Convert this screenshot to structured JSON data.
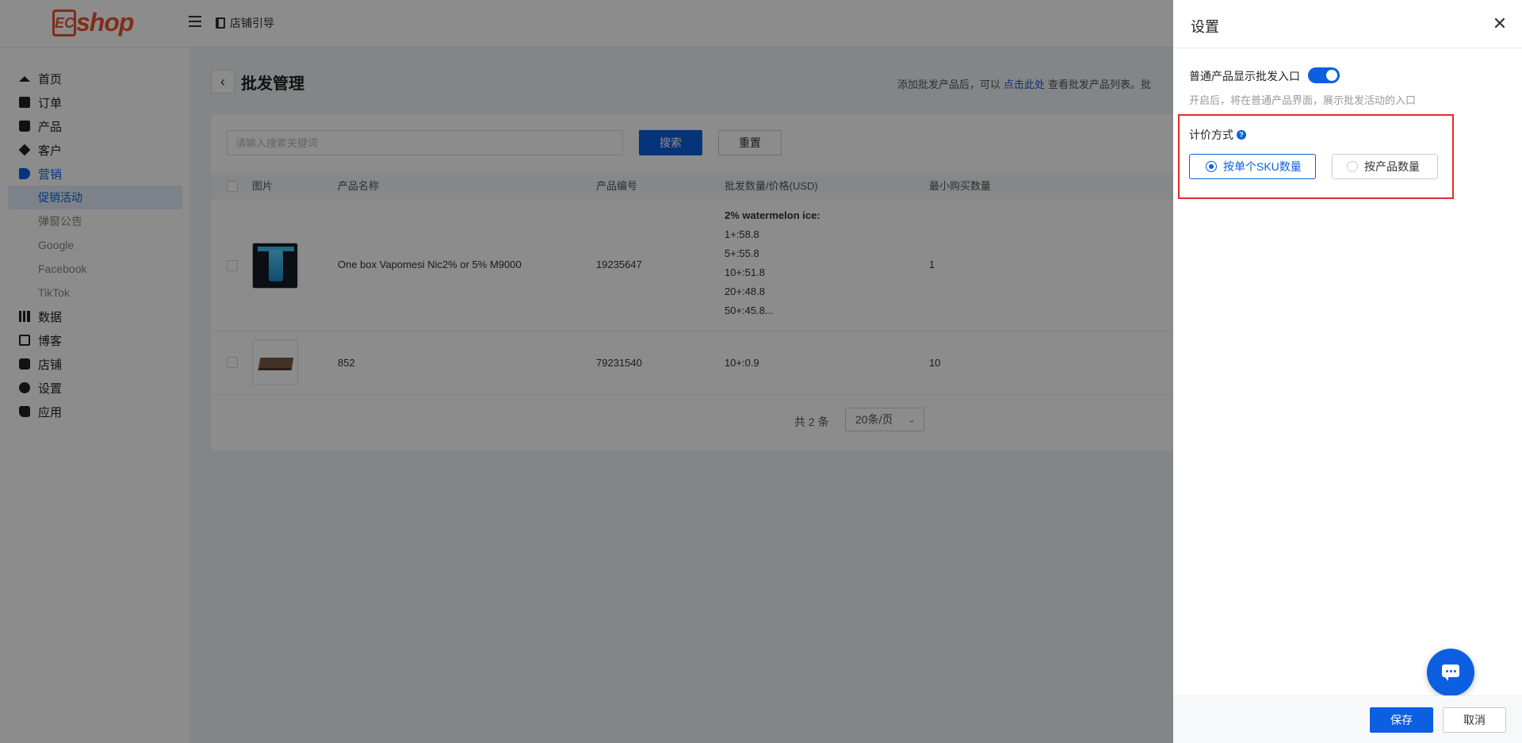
{
  "header": {
    "logo_prefix": "EC",
    "logo_text": "shop",
    "store_guide": "店铺引导"
  },
  "sidebar": {
    "items": [
      {
        "label": "首页",
        "icon": "home-icon"
      },
      {
        "label": "订单",
        "icon": "clipboard-icon"
      },
      {
        "label": "产品",
        "icon": "bag-icon"
      },
      {
        "label": "客户",
        "icon": "diamond-icon"
      },
      {
        "label": "营销",
        "icon": "tag-icon"
      },
      {
        "label": "数据",
        "icon": "bar-chart-icon"
      },
      {
        "label": "博客",
        "icon": "edit-icon"
      },
      {
        "label": "店铺",
        "icon": "store-icon"
      },
      {
        "label": "设置",
        "icon": "gear-icon"
      },
      {
        "label": "应用",
        "icon": "puzzle-icon"
      }
    ],
    "marketing_sub": [
      "促销活动",
      "弹窗公告",
      "Google",
      "Facebook",
      "TikTok"
    ]
  },
  "main": {
    "title": "批发管理",
    "hint_prefix": "添加批发产品后，可以",
    "hint_link": "点击此处",
    "hint_suffix": "查看批发产品列表。批",
    "search_placeholder": "请输入搜索关键词",
    "search_button": "搜索",
    "reset_button": "重置",
    "columns": [
      "图片",
      "产品名称",
      "产品编号",
      "批发数量/价格(USD)",
      "最小购买数量"
    ],
    "rows": [
      {
        "name": "One box Vapomesi Nic2% or 5% M9000",
        "code": "19235647",
        "price_header": "2% watermelon ice:",
        "prices": [
          "1+:58.8",
          "5+:55.8",
          "10+:51.8",
          "20+:48.8",
          "50+:45.8..."
        ],
        "min_qty": "1"
      },
      {
        "name": "852",
        "code": "79231540",
        "price_header": "",
        "prices": [
          "10+:0.9"
        ],
        "min_qty": "10"
      }
    ],
    "pager": {
      "total": "共 2 条",
      "page_size": "20条/页"
    }
  },
  "drawer": {
    "title": "设置",
    "option_label": "普通产品显示批发入口",
    "option_enabled": true,
    "option_desc": "开启后，将在普通产品界面，展示批发活动的入口",
    "pricing_label": "计价方式",
    "pricing_options": [
      "按单个SKU数量",
      "按产品数量"
    ],
    "pricing_selected": "按单个SKU数量",
    "save_button": "保存",
    "cancel_button": "取消"
  },
  "colors": {
    "accent": "#0b5fe0",
    "logo": "#e8542e",
    "highlight": "#e52a2a"
  }
}
